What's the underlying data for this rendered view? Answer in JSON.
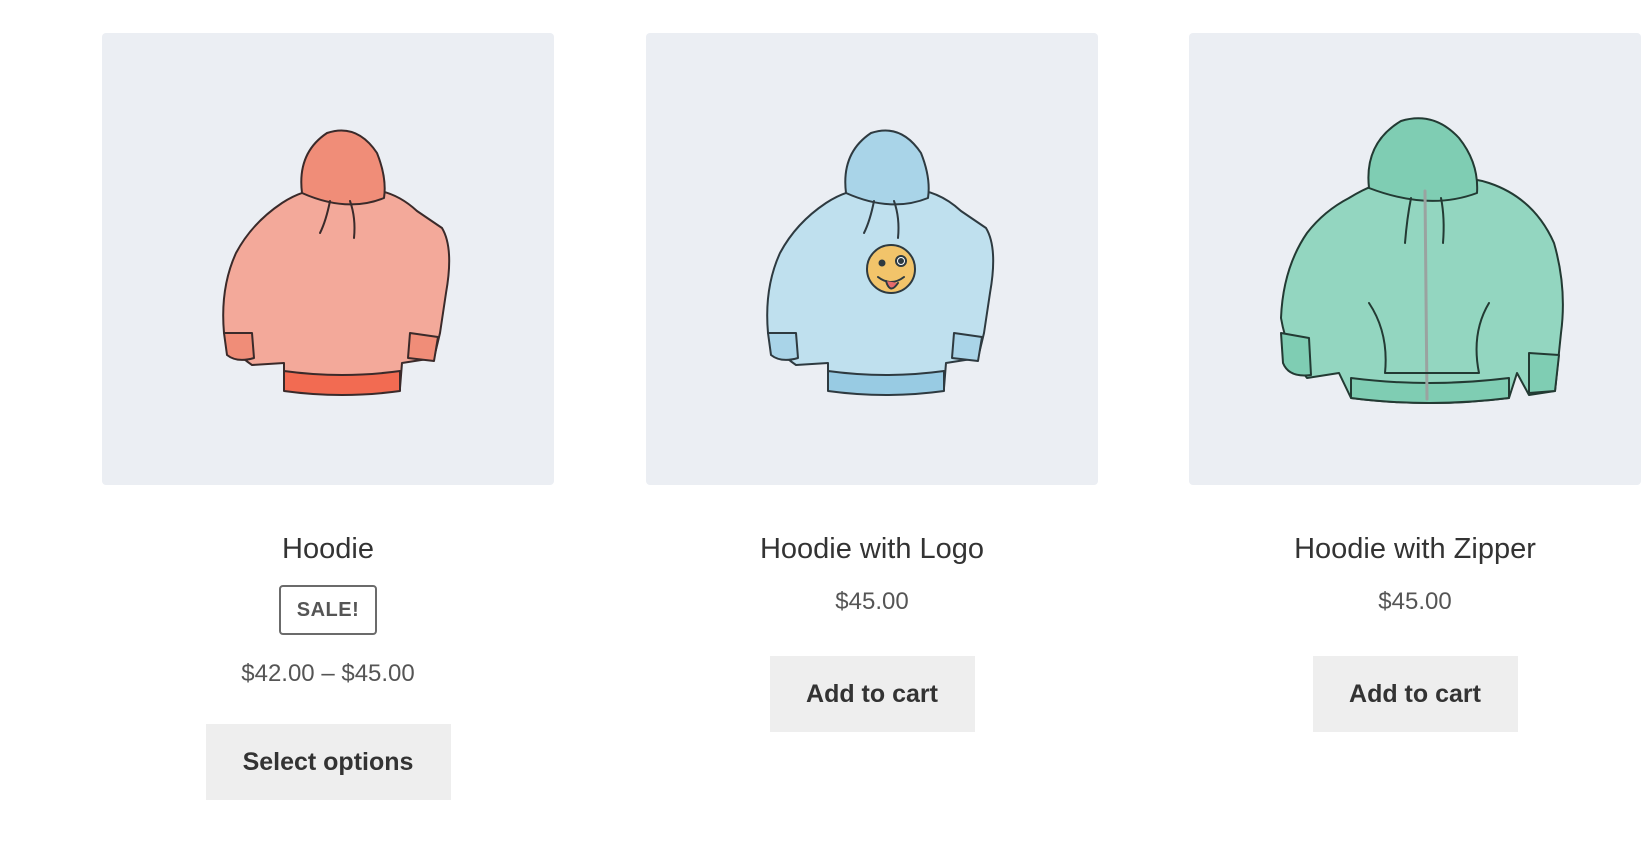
{
  "products": [
    {
      "title": "Hoodie",
      "badge": "SALE!",
      "price": "$42.00 – $45.00",
      "button": "Select options",
      "image_icon": "hoodie-red-icon",
      "color": "#f3a192"
    },
    {
      "title": "Hoodie with Logo",
      "price": "$45.00",
      "button": "Add to cart",
      "image_icon": "hoodie-blue-logo-icon",
      "color": "#b9dceb"
    },
    {
      "title": "Hoodie with Zipper",
      "price": "$45.00",
      "button": "Add to cart",
      "image_icon": "hoodie-green-zipper-icon",
      "color": "#8fd3bd"
    }
  ],
  "colors": {
    "card_background": "#ebeef3",
    "button_background": "#eeeeee",
    "text": "#333333"
  }
}
